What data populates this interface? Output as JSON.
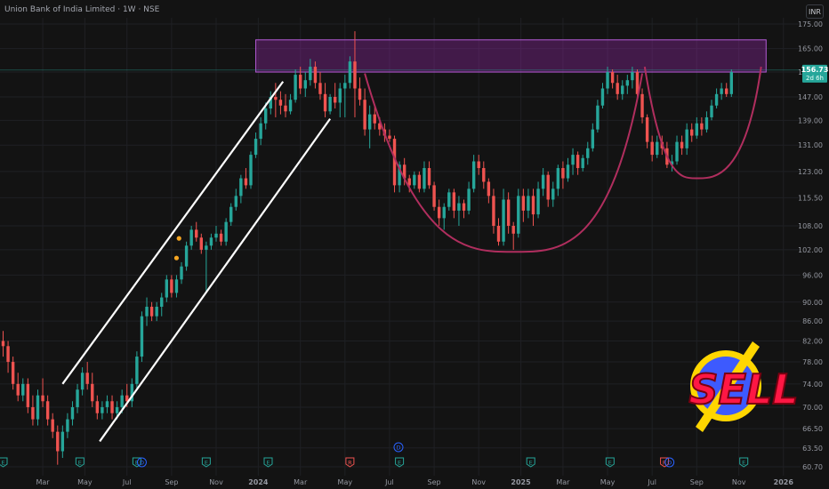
{
  "chart_data": {
    "type": "candlestick",
    "title": "Union Bank of India Limited · 1W · NSE",
    "currency": "INR",
    "y_scale": "log",
    "ylim": [
      60.7,
      175.0
    ],
    "y_ticks": [
      "175.00",
      "165.00",
      "156.00",
      "147.00",
      "139.00",
      "131.00",
      "123.00",
      "115.50",
      "108.00",
      "102.00",
      "96.00",
      "90.00",
      "86.00",
      "82.00",
      "78.00",
      "74.00",
      "70.00",
      "66.50",
      "63.50",
      "60.70"
    ],
    "x_ticks": [
      {
        "label": "Mar",
        "week": 8
      },
      {
        "label": "May",
        "week": 16.5
      },
      {
        "label": "Jul",
        "week": 25
      },
      {
        "label": "Sep",
        "week": 34
      },
      {
        "label": "Nov",
        "week": 43
      },
      {
        "label": "2024",
        "week": 51.5
      },
      {
        "label": "Mar",
        "week": 60
      },
      {
        "label": "May",
        "week": 69
      },
      {
        "label": "Jul",
        "week": 78
      },
      {
        "label": "Sep",
        "week": 87
      },
      {
        "label": "Nov",
        "week": 96
      },
      {
        "label": "2025",
        "week": 104.5
      },
      {
        "label": "Mar",
        "week": 113
      },
      {
        "label": "May",
        "week": 122
      },
      {
        "label": "Jul",
        "week": 131
      },
      {
        "label": "Sep",
        "week": 140
      },
      {
        "label": "Nov",
        "week": 148.5
      },
      {
        "label": "2026",
        "week": 157.5
      }
    ],
    "last_price": "156.73",
    "countdown": "2d 6h",
    "grid": true,
    "colors": {
      "up": "#26a69a",
      "down": "#ef5350",
      "zone": "#9c27b0",
      "arc": "#b02e5e",
      "channel": "#ffffff"
    },
    "resistance_zone": {
      "y_low": 156.0,
      "y_high": 168.5,
      "week_start": 51,
      "week_end": 154
    },
    "channel_lines": [
      {
        "w1": 12,
        "y1": 74.0,
        "w2": 56.5,
        "y2": 152.5
      },
      {
        "w1": 19.5,
        "y1": 64.5,
        "w2": 66,
        "y2": 139.5
      }
    ],
    "cup_arcs": [
      {
        "wStart": 73,
        "wBottom": 103,
        "wEnd": 129,
        "yTop": 155.5,
        "yBottom": 101.5
      },
      {
        "wStart": 129.5,
        "wBottom": 140,
        "wEnd": 153,
        "yTop": 158.0,
        "yBottom": 121.0
      }
    ],
    "dividends": [
      {
        "week": 35.5,
        "y": 104.8
      },
      {
        "week": 35.0,
        "y": 100.0
      }
    ],
    "events": [
      {
        "week": 0,
        "type": "E"
      },
      {
        "week": 15.5,
        "type": "E"
      },
      {
        "week": 27,
        "type": "E"
      },
      {
        "week": 28,
        "type": "D"
      },
      {
        "week": 41,
        "type": "E"
      },
      {
        "week": 53.5,
        "type": "E"
      },
      {
        "week": 70,
        "type": "R"
      },
      {
        "week": 80,
        "type": "E"
      },
      {
        "week": 79.8,
        "type": "D",
        "row": "upper"
      },
      {
        "week": 106.5,
        "type": "E"
      },
      {
        "week": 122.5,
        "type": "E"
      },
      {
        "week": 133.5,
        "type": "R"
      },
      {
        "week": 134.5,
        "type": "D"
      },
      {
        "week": 149.5,
        "type": "E"
      }
    ],
    "ohlc": [
      [
        82,
        84,
        79,
        81
      ],
      [
        81,
        82,
        76,
        78
      ],
      [
        78,
        79,
        73,
        74
      ],
      [
        74,
        76,
        71,
        72
      ],
      [
        72,
        75,
        71,
        74
      ],
      [
        74,
        75,
        69,
        70
      ],
      [
        70,
        72,
        67,
        68
      ],
      [
        68,
        73,
        67,
        72
      ],
      [
        72,
        75,
        70,
        71
      ],
      [
        71,
        72,
        67,
        68
      ],
      [
        68,
        69,
        65,
        66
      ],
      [
        66,
        67,
        61,
        63
      ],
      [
        63,
        67,
        62,
        66
      ],
      [
        66,
        69,
        65,
        68
      ],
      [
        68,
        71,
        67,
        70
      ],
      [
        70,
        74,
        69,
        73
      ],
      [
        73,
        77,
        72,
        76
      ],
      [
        76,
        78,
        73,
        74
      ],
      [
        74,
        76,
        70,
        71
      ],
      [
        71,
        72,
        68,
        69
      ],
      [
        69,
        71,
        68,
        70
      ],
      [
        70,
        72,
        69,
        71
      ],
      [
        71,
        72,
        68,
        69
      ],
      [
        69,
        71,
        68,
        70
      ],
      [
        70,
        73,
        69,
        72
      ],
      [
        72,
        74,
        70,
        71
      ],
      [
        71,
        75,
        70,
        74
      ],
      [
        74,
        80,
        73,
        79
      ],
      [
        79,
        88,
        78,
        87
      ],
      [
        87,
        91,
        85,
        89
      ],
      [
        89,
        90,
        86,
        87
      ],
      [
        87,
        90,
        86,
        89
      ],
      [
        89,
        92,
        87,
        91
      ],
      [
        91,
        96,
        90,
        95
      ],
      [
        95,
        96,
        91,
        92
      ],
      [
        92,
        96,
        91,
        95
      ],
      [
        95,
        99,
        94,
        98
      ],
      [
        98,
        104,
        97,
        103
      ],
      [
        103,
        108,
        102,
        107
      ],
      [
        107,
        109,
        104,
        105
      ],
      [
        105,
        106,
        101,
        102
      ],
      [
        102,
        104,
        92,
        103
      ],
      [
        103,
        106,
        102,
        105
      ],
      [
        105,
        108,
        104,
        106
      ],
      [
        106,
        107,
        103,
        104
      ],
      [
        104,
        110,
        103,
        109
      ],
      [
        109,
        114,
        108,
        113
      ],
      [
        113,
        118,
        112,
        116
      ],
      [
        116,
        122,
        114,
        121
      ],
      [
        121,
        124,
        118,
        119
      ],
      [
        119,
        129,
        118,
        128
      ],
      [
        128,
        135,
        127,
        133
      ],
      [
        133,
        140,
        131,
        138
      ],
      [
        138,
        145,
        136,
        143
      ],
      [
        143,
        149,
        141,
        147
      ],
      [
        147,
        152,
        140,
        146
      ],
      [
        146,
        149,
        141,
        144
      ],
      [
        144,
        148,
        140,
        142
      ],
      [
        142,
        148,
        141,
        146
      ],
      [
        146,
        157,
        145,
        155
      ],
      [
        155,
        158,
        148,
        150
      ],
      [
        150,
        156,
        147,
        153
      ],
      [
        153,
        161,
        151,
        158
      ],
      [
        158,
        160,
        150,
        152
      ],
      [
        152,
        156,
        146,
        148
      ],
      [
        148,
        152,
        140,
        142
      ],
      [
        142,
        148,
        141,
        147
      ],
      [
        147,
        152,
        143,
        145
      ],
      [
        145,
        152,
        140,
        150
      ],
      [
        150,
        155,
        140,
        152
      ],
      [
        152,
        162,
        150,
        160
      ],
      [
        160,
        172,
        140,
        150
      ],
      [
        150,
        154,
        144,
        146
      ],
      [
        146,
        150,
        134,
        136
      ],
      [
        136,
        144,
        130,
        141
      ],
      [
        141,
        144,
        136,
        138
      ],
      [
        138,
        140,
        134,
        136
      ],
      [
        136,
        138,
        132,
        134
      ],
      [
        134,
        136,
        132,
        133
      ],
      [
        133,
        134,
        117,
        119
      ],
      [
        119,
        126,
        117,
        125
      ],
      [
        125,
        127,
        119,
        121
      ],
      [
        121,
        122,
        117,
        119
      ],
      [
        119,
        123,
        118,
        122
      ],
      [
        122,
        123,
        117,
        118
      ],
      [
        118,
        126,
        117,
        124
      ],
      [
        124,
        126,
        118,
        119
      ],
      [
        119,
        120,
        112,
        113
      ],
      [
        113,
        115,
        108,
        110
      ],
      [
        110,
        114,
        107,
        113
      ],
      [
        113,
        118,
        112,
        117
      ],
      [
        117,
        118,
        110,
        112
      ],
      [
        112,
        116,
        108,
        114
      ],
      [
        114,
        115,
        110,
        112
      ],
      [
        112,
        120,
        111,
        118
      ],
      [
        118,
        128,
        117,
        126
      ],
      [
        126,
        128,
        122,
        124
      ],
      [
        124,
        126,
        118,
        120
      ],
      [
        120,
        121,
        114,
        116
      ],
      [
        116,
        118,
        106,
        108
      ],
      [
        108,
        110,
        103,
        104
      ],
      [
        104,
        118,
        103,
        115
      ],
      [
        115,
        117,
        106,
        108
      ],
      [
        108,
        109,
        102,
        106
      ],
      [
        106,
        118,
        105,
        116
      ],
      [
        116,
        118,
        109,
        112
      ],
      [
        112,
        118,
        110,
        116
      ],
      [
        116,
        118,
        108,
        111
      ],
      [
        111,
        120,
        110,
        118
      ],
      [
        118,
        124,
        116,
        122
      ],
      [
        122,
        123,
        113,
        115
      ],
      [
        115,
        120,
        113,
        118
      ],
      [
        118,
        125,
        116,
        124
      ],
      [
        124,
        126,
        118,
        121
      ],
      [
        121,
        127,
        120,
        125
      ],
      [
        125,
        130,
        122,
        128
      ],
      [
        128,
        129,
        122,
        124
      ],
      [
        124,
        128,
        123,
        127
      ],
      [
        127,
        132,
        125,
        130
      ],
      [
        130,
        138,
        129,
        136
      ],
      [
        136,
        146,
        135,
        144
      ],
      [
        144,
        152,
        143,
        150
      ],
      [
        150,
        158,
        148,
        156
      ],
      [
        156,
        157,
        150,
        152
      ],
      [
        152,
        155,
        146,
        148
      ],
      [
        148,
        153,
        146,
        151
      ],
      [
        151,
        155,
        148,
        153
      ],
      [
        153,
        158,
        150,
        156
      ],
      [
        156,
        157,
        146,
        148
      ],
      [
        148,
        150,
        138,
        140
      ],
      [
        140,
        141,
        130,
        132
      ],
      [
        132,
        134,
        126,
        128
      ],
      [
        128,
        134,
        127,
        132
      ],
      [
        132,
        134,
        128,
        130
      ],
      [
        130,
        132,
        124,
        125
      ],
      [
        125,
        128,
        123,
        126
      ],
      [
        126,
        134,
        125,
        132
      ],
      [
        132,
        134,
        128,
        130
      ],
      [
        130,
        138,
        128,
        136
      ],
      [
        136,
        138,
        132,
        134
      ],
      [
        134,
        140,
        133,
        138
      ],
      [
        138,
        140,
        134,
        136
      ],
      [
        136,
        142,
        135,
        140
      ],
      [
        140,
        146,
        139,
        144
      ],
      [
        144,
        150,
        143,
        148
      ],
      [
        148,
        152,
        146,
        150
      ],
      [
        150,
        152,
        147,
        148
      ],
      [
        148,
        157,
        147,
        156
      ]
    ]
  },
  "sell_badge": {
    "text": "SELL",
    "colors": {
      "ring": "#ffd600",
      "disc": "#3d5afe",
      "text": "#ff1744"
    }
  }
}
